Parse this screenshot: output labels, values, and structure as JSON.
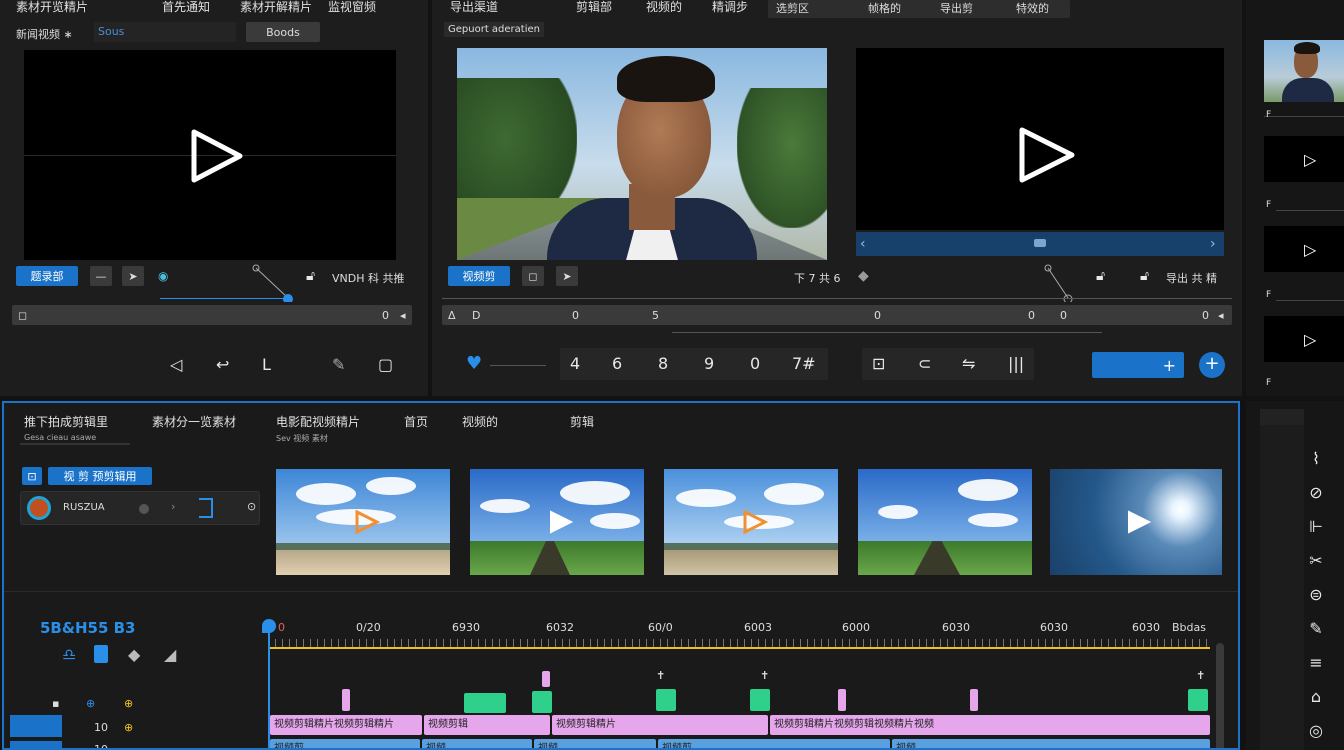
{
  "left_monitor": {
    "title": "素材开览精片",
    "tabs": [
      "首先通知",
      "素材开解精片",
      "监视窗频"
    ],
    "subbar_label": "新闻视频 ∗",
    "subbar_field": "Sous",
    "subbar_btn": "Boods",
    "mode_btn": "题录部",
    "status_text": "VNDH 科 共推",
    "timecode": "0",
    "controls": [
      "previous-frame",
      "rewind",
      "mark-in",
      "razor",
      "stop"
    ]
  },
  "center_monitor": {
    "tabs": [
      "导出渠道",
      "剪辑部",
      "视频的",
      "精调步"
    ],
    "search_segments": [
      "选剪区",
      "帧格的",
      "导出剪",
      "特效的"
    ],
    "subheader": "Gepuort aderatien",
    "mode_btn": "视频剪",
    "left_label": "下 7 共 6",
    "right_label": "导出 共 精",
    "timecode": "0",
    "ruler_labels": [
      "Δ",
      "D",
      "0",
      "5",
      "0",
      "0",
      "0",
      "5"
    ],
    "numpad": [
      "4",
      "6",
      "8",
      "9",
      "0",
      "7#"
    ]
  },
  "right_strip": {
    "labels": [
      "F",
      "F",
      "F",
      "F"
    ]
  },
  "media_browser": {
    "tabs": [
      "推下拍成剪辑里",
      "素材分一览素材",
      "电影配视频精片",
      "首页",
      "视频的",
      "剪辑"
    ],
    "sub_tabs": [
      "Gesa cieau asawe",
      "Sev 视频 素材"
    ],
    "blue_chip_1": "⊡",
    "blue_chip_2": "视 剪 预剪辑用",
    "item_name": "RUSZUA",
    "thumbs": [
      "sky-field-1",
      "sky-field-2",
      "sky-field-3",
      "sky-field-4",
      "lens-flare"
    ]
  },
  "timeline": {
    "sequence_label": "5B&H55 B3",
    "playhead_label": "0",
    "ruler": [
      "0/20",
      "6930",
      "6032",
      "60/0",
      "6003",
      "6000",
      "6030",
      "6030",
      "6030",
      "Bbdas"
    ],
    "track_rows": [
      "V1",
      "A1",
      "A2",
      "A3"
    ],
    "track_labels": [
      "10",
      "10"
    ],
    "clip_labels": [
      "视频剪辑精片视频剪辑精片",
      "视频剪辑",
      "视频剪辑精片",
      "视频剪辑精片视频剪辑视频精片视频"
    ],
    "blue_clip_labels": [
      "视频剪",
      "视频",
      "视频",
      "视频剪",
      "视频"
    ]
  },
  "colors": {
    "accent": "#1a73c8",
    "pink_clip": "#e6a6ec",
    "green_marker": "#2fd08c",
    "blue_clip": "#5aa0e0",
    "timeline_line": "#f0c020"
  }
}
